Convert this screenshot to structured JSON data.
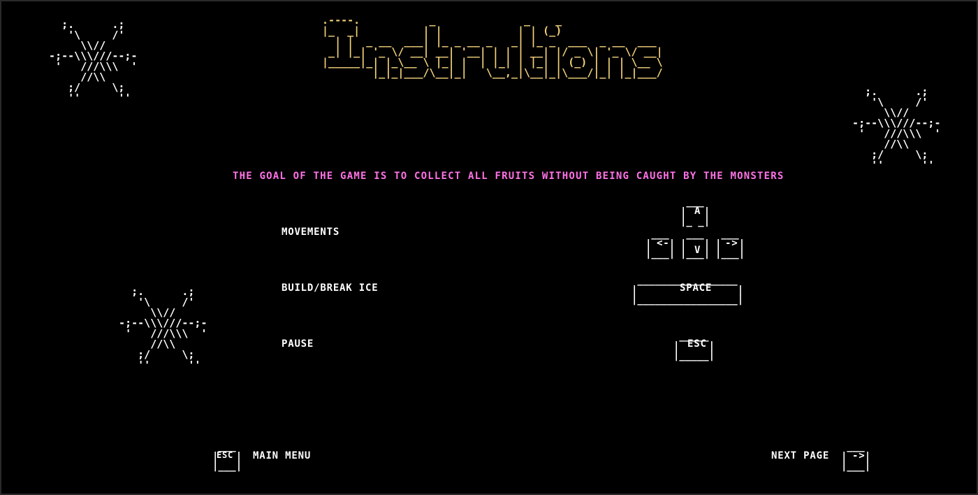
{
  "screen": {
    "title": "Instructions",
    "accent_color": "#f2d27a",
    "goal_color": "#ff73e6"
  },
  "goal_text": "THE GOAL OF THE GAME IS TO COLLECT ALL FRUITS WITHOUT BEING CAUGHT BY THE MONSTERS",
  "controls": [
    {
      "label": "MOVEMENTS",
      "key": "arrow-keys"
    },
    {
      "label": "BUILD/BREAK ICE",
      "key": "SPACE"
    },
    {
      "label": "PAUSE",
      "key": "ESC"
    }
  ],
  "keys": {
    "up": "A",
    "left": "<-",
    "down": "V",
    "right": "->",
    "space": "SPACE",
    "esc": "ESC"
  },
  "navigation": {
    "main_menu_key": "ESC",
    "main_menu_label": "MAIN MENU",
    "next_page_label": "NEXT PAGE",
    "next_page_key": "->"
  },
  "decorations": {
    "snowflake_icon": "snowflake-icon"
  }
}
